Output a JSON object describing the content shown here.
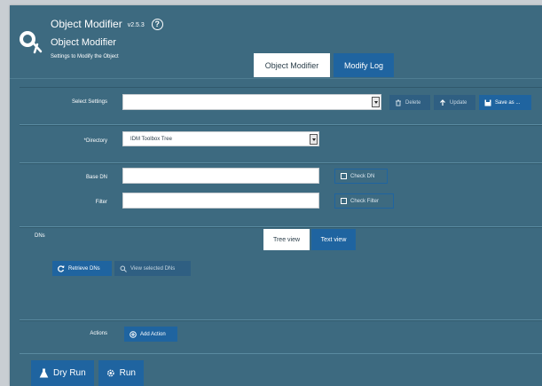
{
  "header": {
    "app_title": "Object Modifier",
    "version": "v2.5.3",
    "help_glyph": "?",
    "sub_title": "Object Modifier",
    "description": "Settings to Modify the Object",
    "tabs": [
      {
        "label": "Object Modifier",
        "active": true
      },
      {
        "label": "Modify Log",
        "active": false
      }
    ]
  },
  "settings": {
    "label": "Select Settings",
    "value": "",
    "buttons": {
      "delete": "Delete",
      "update": "Update",
      "save_as": "Save as ..."
    }
  },
  "directory": {
    "label": "*Directory",
    "value": "IDM Toolbox Tree"
  },
  "base_dn": {
    "label": "Base DN",
    "value": "",
    "check_label": "Check DN"
  },
  "filter": {
    "label": "Filter",
    "value": "",
    "check_label": "Check Filter"
  },
  "dns": {
    "label": "DNs",
    "tabs": [
      {
        "label": "Tree view",
        "active": true
      },
      {
        "label": "Text view",
        "active": false
      }
    ],
    "retrieve_label": "Retrieve DNs",
    "view_selected_label": "View selected DNs"
  },
  "actions": {
    "label": "Actions",
    "add_label": "Add Action"
  },
  "footer": {
    "dry_run_label": "Dry Run",
    "run_label": "Run"
  },
  "icons": {
    "logo": "object-modifier-logo-icon",
    "help": "help-circle-icon",
    "delete": "trash-icon",
    "update": "upload-icon",
    "save": "save-icon",
    "check": "checkbox-icon",
    "retrieve": "refresh-icon",
    "view": "search-icon",
    "add": "plus-circle-icon",
    "dry_run": "flask-icon",
    "run": "gear-icon"
  },
  "colors": {
    "panel": "#3d6a80",
    "accent": "#1f64a0",
    "page": "#c9ced3"
  }
}
